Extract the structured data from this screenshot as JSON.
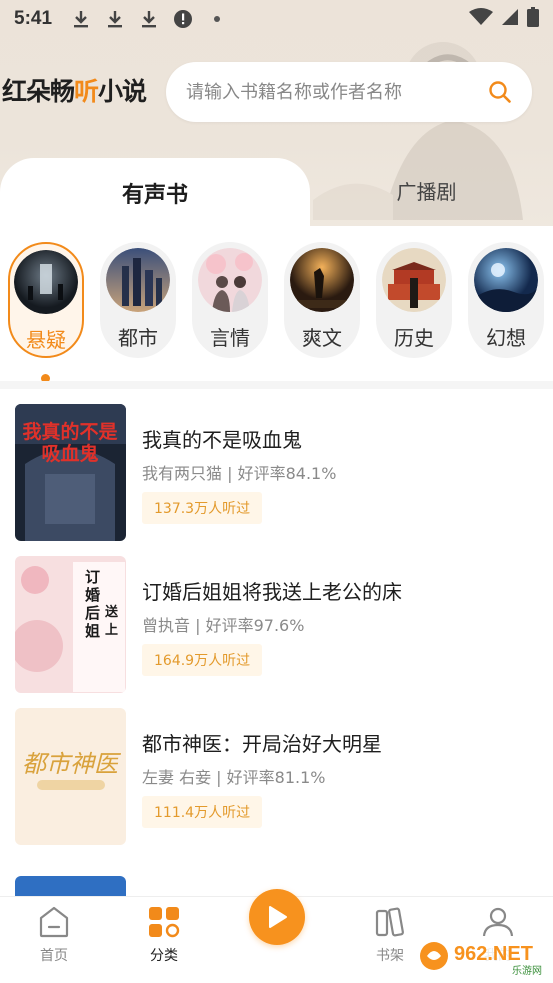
{
  "status_bar": {
    "time": "5:41"
  },
  "app": {
    "logo_text": "红朵畅",
    "logo_ting": "听",
    "logo_tail": "小说"
  },
  "search": {
    "placeholder": "请输入书籍名称或作者名称",
    "value": ""
  },
  "tabs": [
    {
      "label": "有声书",
      "active": true
    },
    {
      "label": "广播剧",
      "active": false
    }
  ],
  "categories": [
    {
      "label": "悬疑",
      "active": true,
      "icon": "mystery-thumb"
    },
    {
      "label": "都市",
      "active": false,
      "icon": "city-thumb"
    },
    {
      "label": "言情",
      "active": false,
      "icon": "romance-thumb"
    },
    {
      "label": "爽文",
      "active": false,
      "icon": "thrill-thumb"
    },
    {
      "label": "历史",
      "active": false,
      "icon": "history-thumb"
    },
    {
      "label": "幻想",
      "active": false,
      "icon": "fantasy-thumb"
    }
  ],
  "books": [
    {
      "title": "我真的不是吸血鬼",
      "author": "我有两只猫",
      "rating": "好评率84.1%",
      "listens": "137.3万人听过",
      "cover_text": "我真的不是吸血鬼"
    },
    {
      "title": "订婚后姐姐将我送上老公的床",
      "author": "曾执音",
      "rating": "好评率97.6%",
      "listens": "164.9万人听过",
      "cover_text": "订婚后姐姐将我送上老公的床"
    },
    {
      "title": "都市神医：开局治好大明星",
      "author": "左妻 右妾",
      "rating": "好评率81.1%",
      "listens": "111.4万人听过",
      "cover_text": "都市神医"
    }
  ],
  "bottom_nav": [
    {
      "label": "首页",
      "icon": "home-icon",
      "active": false
    },
    {
      "label": "分类",
      "icon": "category-icon",
      "active": true
    },
    {
      "label": "书架",
      "icon": "bookshelf-icon",
      "active": false
    },
    {
      "label": "我的",
      "icon": "profile-icon",
      "active": false
    }
  ],
  "watermark": {
    "text": "962.NET",
    "sub": "乐游网"
  },
  "colors": {
    "accent": "#f28a1a",
    "badge_bg": "#fff6e8",
    "badge_text": "#e39a2c"
  }
}
